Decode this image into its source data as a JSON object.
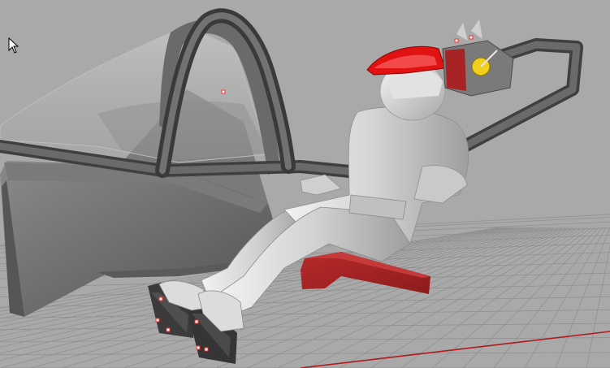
{
  "viewport": {
    "background": "#a9a9a9",
    "grid_color": "#8e8e8e",
    "x_axis_color": "#b11a1a",
    "accent_red": "#e01212",
    "dark_red": "#a82424",
    "figure_color": "#d8d8d8",
    "frame_color": "#5c5c5c",
    "yellow": "#f2cf1c",
    "control_point_color": "#ff2a2a"
  },
  "icons": [
    "mouse-pointer-icon"
  ]
}
